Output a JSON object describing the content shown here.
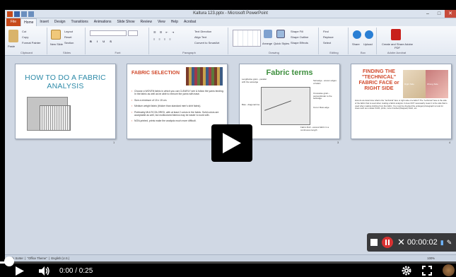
{
  "window": {
    "title": "Kaltura 123.pptx - Microsoft PowerPoint"
  },
  "ribbon": {
    "file_tab": "File",
    "tabs": [
      "Home",
      "Insert",
      "Design",
      "Transitions",
      "Animations",
      "Slide Show",
      "Review",
      "View",
      "Help",
      "Acrobat"
    ],
    "groups": {
      "clipboard": {
        "label": "Clipboard",
        "paste": "Paste",
        "cut": "Cut",
        "copy": "Copy",
        "format_painter": "Format Painter"
      },
      "slides": {
        "label": "Slides",
        "new_slide": "New Slide",
        "layout": "Layout",
        "reset": "Reset",
        "section": "Section"
      },
      "font": {
        "label": "Font"
      },
      "paragraph": {
        "label": "Paragraph",
        "text_direction": "Text Direction",
        "align_text": "Align Text",
        "convert": "Convert to SmartArt"
      },
      "drawing": {
        "label": "Drawing",
        "arrange": "Arrange",
        "quick_styles": "Quick Styles",
        "shape_fill": "Shape Fill",
        "shape_outline": "Shape Outline",
        "shape_effects": "Shape Effects"
      },
      "editing": {
        "label": "Editing",
        "find": "Find",
        "replace": "Replace",
        "select": "Select"
      },
      "box": {
        "label": "Box",
        "share": "Share",
        "upload": "Upload"
      },
      "acrobat": {
        "label": "Adobe Acrobat",
        "create": "Create and Share Adobe PDF"
      }
    }
  },
  "slides": [
    {
      "number": "1",
      "title": "HOW TO DO A FABRIC ANALYSIS"
    },
    {
      "number": "2",
      "title": "FABRIC SELECTION",
      "bullets": [
        "Choose a WOVEN fabric in which you can CLEARLY see & follow the yarns binding. In the fabric as well as be able to remove the yarns with ease.",
        "Size a minimum of 15 x 15 cm.",
        "Medium weight fabric (thicker than standard men's shirt fabric).",
        "Preferably MULTICOLORED, with at least 2 colors in the fabric. Solid colors are acceptable as well, but multicolored fabrics may be easier to work with.",
        "NON-printed, prints make the analysis much more difficult."
      ]
    },
    {
      "number": "3",
      "title": "Fabric terms",
      "labels": [
        "Lengthwise grain - parallel with the selvedge",
        "Selvedge - woven edges of fabric",
        "Crosswise grain - perpendicular to the selvedge",
        "Bias - diagonal line",
        "Cut or Raw edge",
        "Fabric Roll - excess fabric in a continuous length"
      ]
    },
    {
      "number": "4",
      "title": "FINDING THE \"TECHNICAL\" FABRIC FACE or RIGHT SIDE",
      "image_labels": [
        "Right Side",
        "Wrong Side"
      ],
      "body": "How do we determine what is the \"technical\" face or right side of a fabric? The \"technical\" face is the side of the fabric that is used when making a fabric analysis. It does NOT necessarily mean it is the side that is used when making clothing from the fabric. You must be checked the enlarged photograph to look for clues such as a neater finish, prints, more brushed (Napped) finish, etc."
    }
  ],
  "statusbar": {
    "slide_sorter": "Slide Sorter",
    "theme": "\"Office Theme\"",
    "language": "English (U.S.)",
    "zoom": "100%"
  },
  "recorder": {
    "time": "00:00:02"
  },
  "player": {
    "timecode": "0:00 / 0:25",
    "progress": 0.02
  }
}
